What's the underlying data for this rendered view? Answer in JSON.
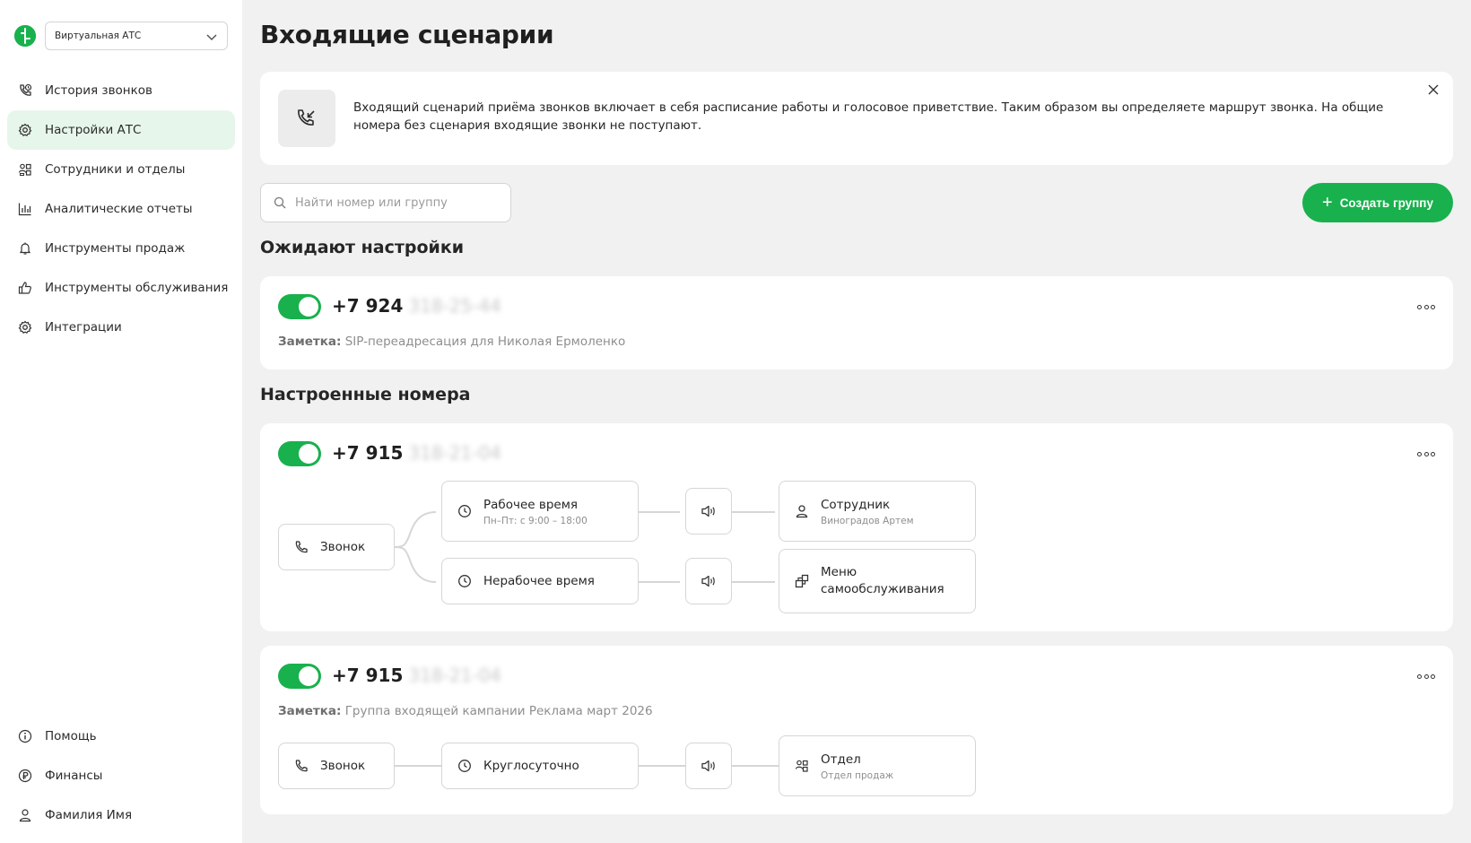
{
  "sidebar": {
    "select_value": "Виртуальная АТС",
    "nav": [
      {
        "label": "История звонков",
        "icon": "call-history-icon"
      },
      {
        "label": "Настройки АТС",
        "icon": "gear-icon",
        "active": true
      },
      {
        "label": "Сотрудники и отделы",
        "icon": "users-icon"
      },
      {
        "label": "Аналитические отчеты",
        "icon": "bar-chart-icon"
      },
      {
        "label": "Инструменты продаж",
        "icon": "bell-icon"
      },
      {
        "label": "Инструменты обслуживания",
        "icon": "thumb-up-icon"
      },
      {
        "label": "Интеграции",
        "icon": "integration-gear-icon"
      }
    ],
    "bottom": [
      {
        "label": "Помощь",
        "icon": "info-icon"
      },
      {
        "label": "Финансы",
        "icon": "ruble-icon"
      },
      {
        "label": "Фамилия Имя",
        "icon": "user-icon"
      }
    ]
  },
  "main": {
    "title": "Входящие сценарии",
    "info_text": "Входящий сценарий приёма звонков включает в себя расписание работы и голосовое приветствие. Таким образом вы определяете маршрут звонка. На общие номера без сценария входящие звонки не поступают.",
    "search_placeholder": "Найти номер или группу",
    "create_button": "Создать группу",
    "section_pending": "Ожидают настройки",
    "section_configured": "Настроенные номера",
    "note_label": "Заметка:",
    "cards": [
      {
        "phone_prefix": "+7 924",
        "phone_hidden": "318-25-44",
        "note": "SIP-переадресация для Николая Ермоленко"
      },
      {
        "phone_prefix": "+7 915",
        "phone_hidden": "318-21-04",
        "flow": {
          "start": "Звонок",
          "work_time": "Рабочее время",
          "work_time_sub": "Пн–Пт: с 9:00 – 18:00",
          "off_time": "Нерабочее время",
          "employee": "Сотрудник",
          "employee_sub": "Виноградов Артем",
          "self_service": "Меню самообслуживания"
        }
      },
      {
        "phone_prefix": "+7 915",
        "phone_hidden": "318-21-04",
        "note": "Группа входящей кампании Реклама март 2026",
        "flow": {
          "start": "Звонок",
          "schedule": "Круглосуточно",
          "department": "Отдел",
          "department_sub": "Отдел продаж"
        }
      }
    ]
  },
  "colors": {
    "accent": "#19b14d",
    "active_bg": "#e7f6eb",
    "background": "#f1f1f1"
  }
}
